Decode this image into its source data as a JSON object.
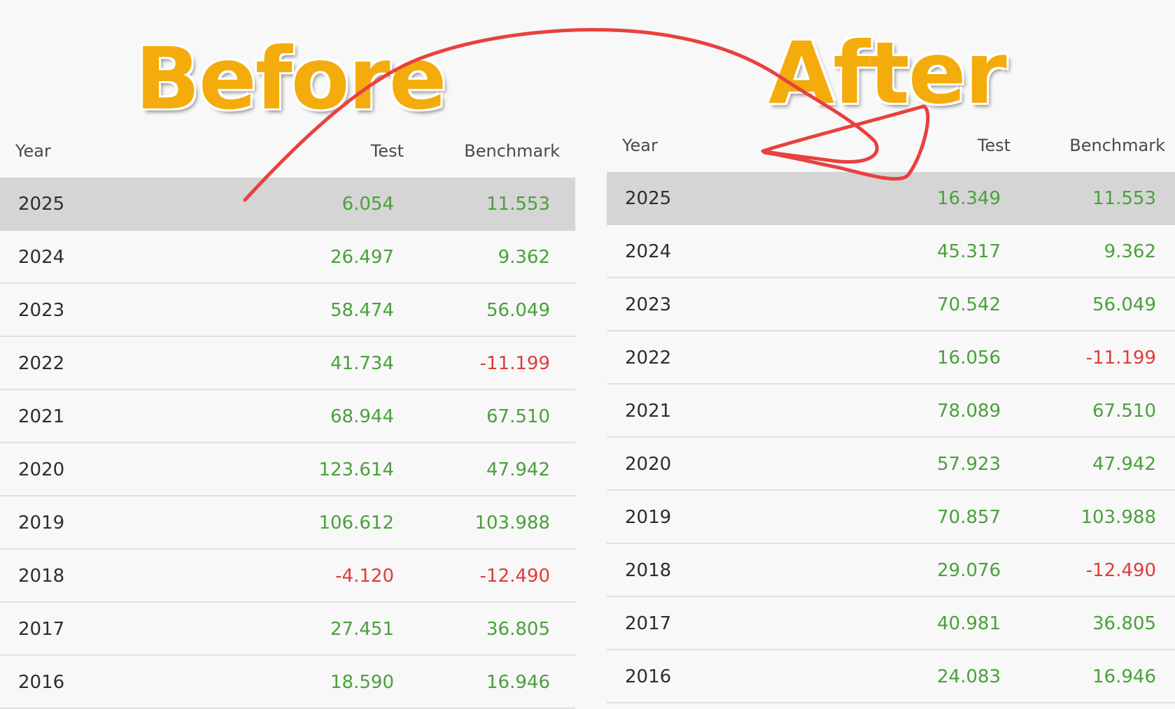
{
  "labels": {
    "before": "Before",
    "after": "After"
  },
  "columns": {
    "year": "Year",
    "test": "Test",
    "benchmark": "Benchmark"
  },
  "colors": {
    "positive": "#4aa03c",
    "negative": "#e03b3b",
    "label": "#f4ac0c",
    "highlight_row": "#d5d5d5",
    "annotation_stroke": "#e8413f"
  },
  "before": {
    "rows": [
      {
        "year": "2025",
        "test": "6.054",
        "benchmark": "11.553"
      },
      {
        "year": "2024",
        "test": "26.497",
        "benchmark": "9.362"
      },
      {
        "year": "2023",
        "test": "58.474",
        "benchmark": "56.049"
      },
      {
        "year": "2022",
        "test": "41.734",
        "benchmark": "-11.199"
      },
      {
        "year": "2021",
        "test": "68.944",
        "benchmark": "67.510"
      },
      {
        "year": "2020",
        "test": "123.614",
        "benchmark": "47.942"
      },
      {
        "year": "2019",
        "test": "106.612",
        "benchmark": "103.988"
      },
      {
        "year": "2018",
        "test": "-4.120",
        "benchmark": "-12.490"
      },
      {
        "year": "2017",
        "test": "27.451",
        "benchmark": "36.805"
      },
      {
        "year": "2016",
        "test": "18.590",
        "benchmark": "16.946"
      }
    ]
  },
  "after": {
    "rows": [
      {
        "year": "2025",
        "test": "16.349",
        "benchmark": "11.553"
      },
      {
        "year": "2024",
        "test": "45.317",
        "benchmark": "9.362"
      },
      {
        "year": "2023",
        "test": "70.542",
        "benchmark": "56.049"
      },
      {
        "year": "2022",
        "test": "16.056",
        "benchmark": "-11.199"
      },
      {
        "year": "2021",
        "test": "78.089",
        "benchmark": "67.510"
      },
      {
        "year": "2020",
        "test": "57.923",
        "benchmark": "47.942"
      },
      {
        "year": "2019",
        "test": "70.857",
        "benchmark": "103.988"
      },
      {
        "year": "2018",
        "test": "29.076",
        "benchmark": "-12.490"
      },
      {
        "year": "2017",
        "test": "40.981",
        "benchmark": "36.805"
      },
      {
        "year": "2016",
        "test": "24.083",
        "benchmark": "16.946"
      }
    ]
  }
}
